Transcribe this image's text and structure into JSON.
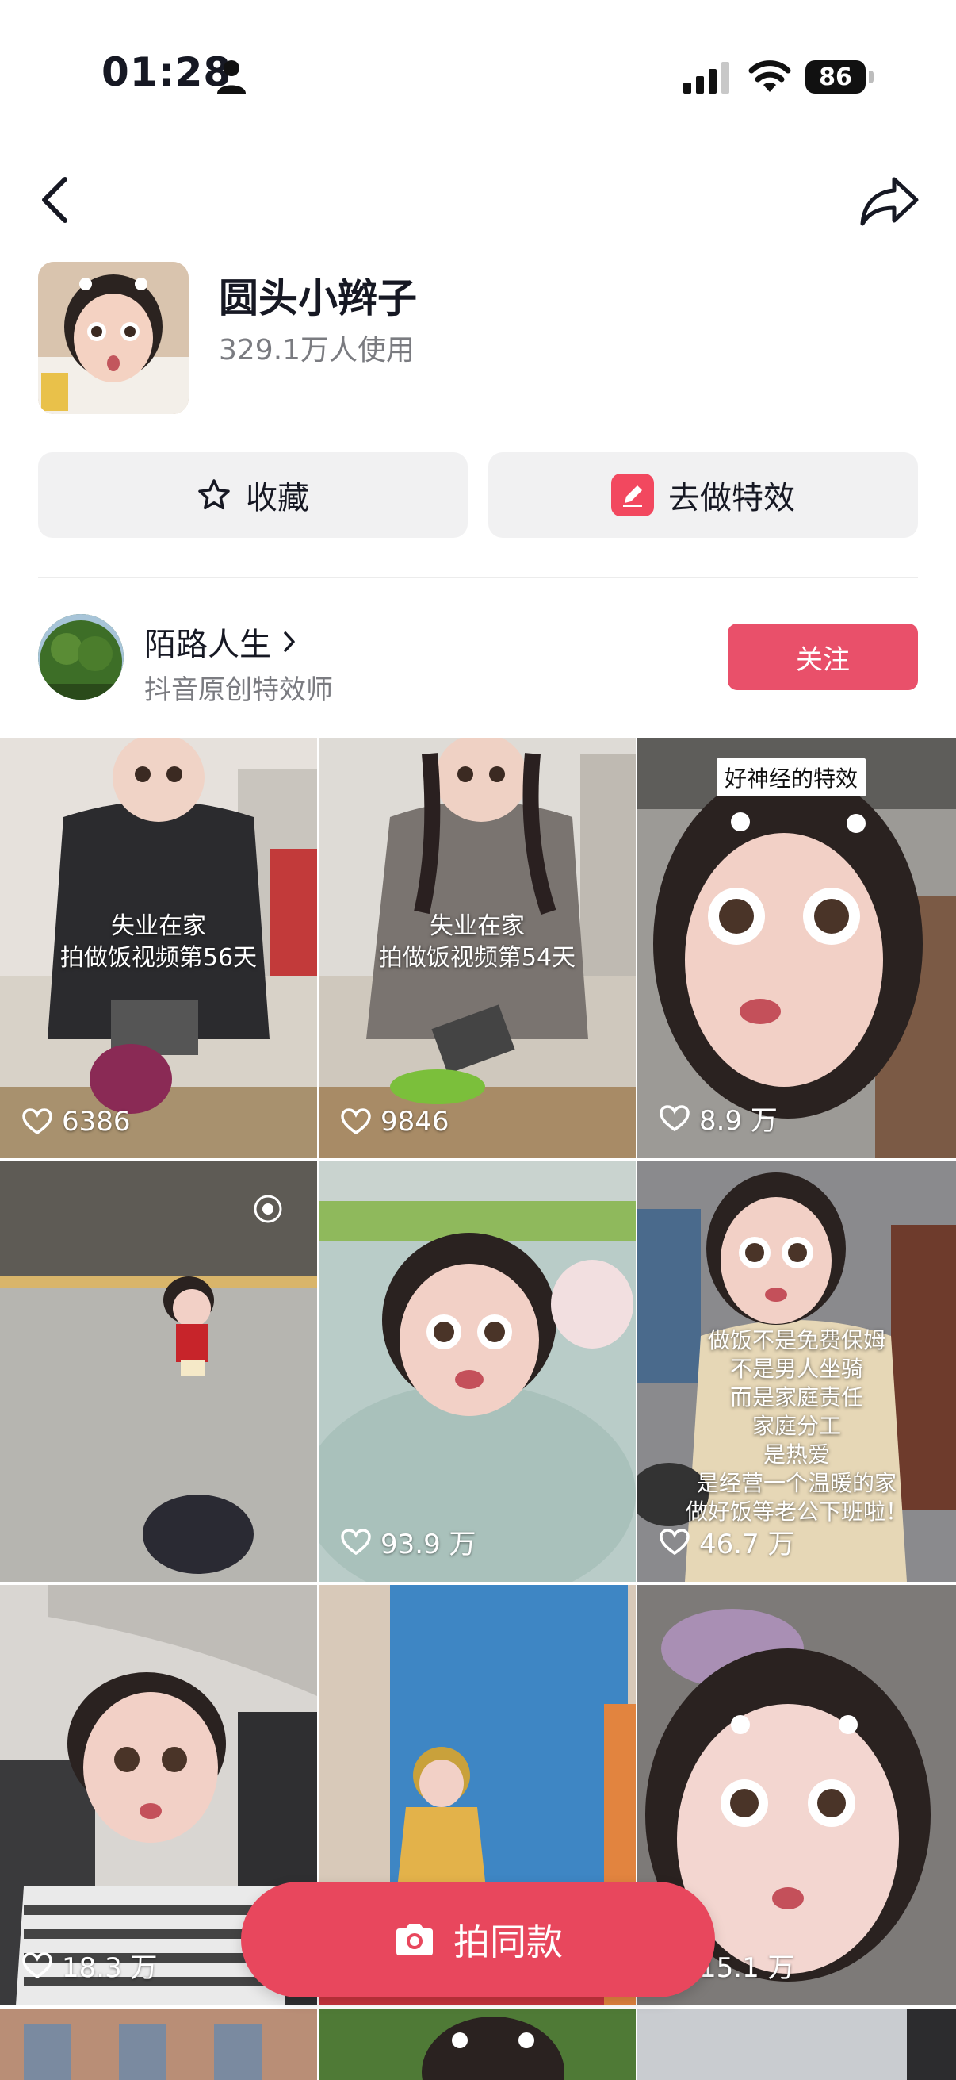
{
  "status_bar": {
    "time": "01:28",
    "battery": "86"
  },
  "effect": {
    "name": "圆头小辫子",
    "users": "329.1万人使用"
  },
  "actions": {
    "collect_label": "收藏",
    "make_label": "去做特效"
  },
  "creator": {
    "name": "陌路人生",
    "role": "抖音原创特效师",
    "follow_label": "关注"
  },
  "videos": [
    {
      "likes": "6386",
      "caption": [
        "失业在家",
        "拍做饭视频第56天"
      ]
    },
    {
      "likes": "9846",
      "caption": [
        "失业在家",
        "拍做饭视频第54天"
      ]
    },
    {
      "likes": "8.9 万",
      "tag": "好神经的特效"
    },
    {
      "likes": ""
    },
    {
      "likes": "93.9 万"
    },
    {
      "likes": "46.7 万",
      "caption": [
        "做饭不是免费保姆",
        "不是男人坐骑",
        "而是家庭责任",
        "家庭分工",
        "是热爱",
        "是经营一个温暖的家",
        "做好饭等老公下班啦！"
      ]
    },
    {
      "likes": "18.3 万"
    },
    {
      "likes": ""
    },
    {
      "likes": "15.1 万"
    }
  ],
  "shoot_button": {
    "label": "拍同款"
  },
  "colors": {
    "accent": "#e8475d",
    "follow": "#e9506a",
    "make_icon": "#f2485f"
  }
}
